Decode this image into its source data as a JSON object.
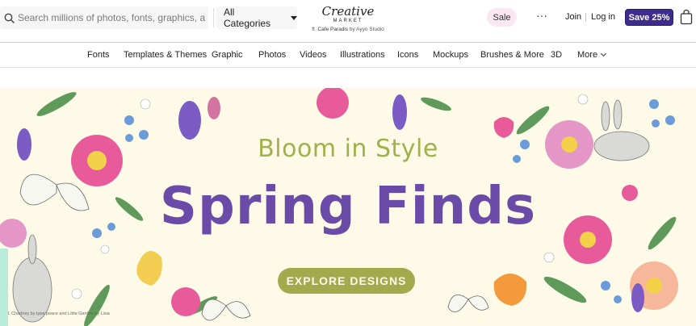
{
  "header": {
    "search": {
      "placeholder": "Search millions of photos, fonts, graphics, and mo...",
      "icon": "search-icon"
    },
    "categories": {
      "label": "All Categories"
    },
    "logo": {
      "script": "Creative",
      "market": "MARKET",
      "sub_prefix": "ft.",
      "sub_bold": "Cafe Paradis",
      "sub_suffix": "by Ayyo Studio"
    },
    "sale_label": "Sale",
    "more_dots": "···",
    "join_label": "Join",
    "separator": "|",
    "login_label": "Log in",
    "save_label": "Save 25%",
    "accent_color": "#3d2b8e"
  },
  "nav": {
    "items": [
      "Fonts",
      "Templates & Themes",
      "Graphic",
      "Photos",
      "Videos",
      "Illustrations",
      "Icons",
      "Mockups",
      "Brushes & More",
      "3D"
    ],
    "more_label": "More"
  },
  "hero": {
    "eyebrow": "Bloom in Style",
    "headline": "Spring Finds",
    "cta_label": "EXPLORE DESIGNS",
    "credit": "ft. Charlney by type peace and Little Garden by Lisia",
    "colors": {
      "background": "#fdfbe8",
      "headline": "#6a4ba8",
      "eyebrow": "#a2b04b",
      "cta": "#a1ab4e"
    }
  }
}
